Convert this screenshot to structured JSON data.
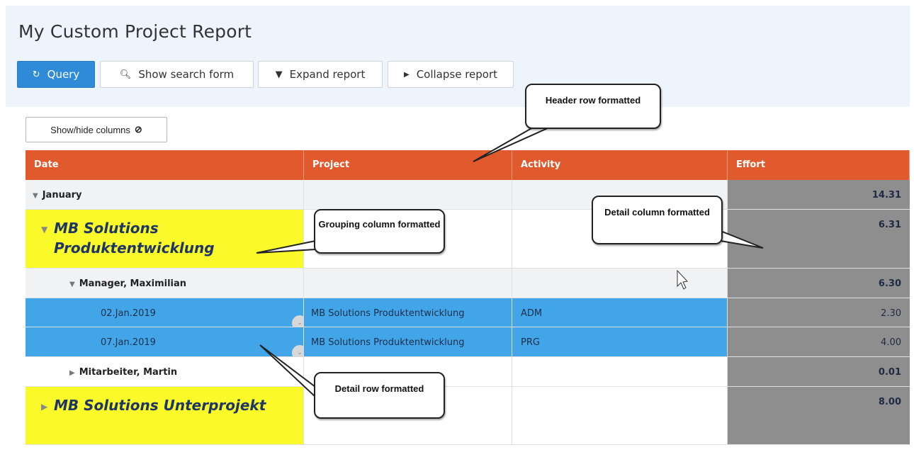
{
  "page": {
    "title": "My Custom Project Report"
  },
  "toolbar": {
    "query": "Query",
    "show_search_form": "Show search form",
    "expand_report": "Expand report",
    "collapse_report": "Collapse report",
    "show_hide_columns": "Show/hide columns"
  },
  "table": {
    "headers": [
      "Date",
      "Project",
      "Activity",
      "Effort"
    ],
    "rows": [
      {
        "label": "January",
        "effort": "14.31"
      },
      {
        "label": "MB Solutions Produktentwicklung",
        "effort": "6.31"
      },
      {
        "label": "Manager, Maximilian",
        "effort": "6.30"
      },
      {
        "date": "02.Jan.2019",
        "project": "MB Solutions Produktentwicklung",
        "activity": "ADM",
        "effort": "2.30"
      },
      {
        "date": "07.Jan.2019",
        "project": "MB Solutions Produktentwicklung",
        "activity": "PRG",
        "effort": "4.00"
      },
      {
        "label": "Mitarbeiter, Martin",
        "effort": "0.01"
      },
      {
        "label": "MB Solutions Unterprojekt",
        "effort": "8.00"
      }
    ]
  },
  "callouts": {
    "header_row": "Header row formatted",
    "grouping_column": "Grouping column formatted",
    "detail_column": "Detail column formatted",
    "detail_row": "Detail row formatted"
  },
  "colors": {
    "header": "#e05a2e",
    "primary_button": "#2f8ad8",
    "highlight_yellow": "#fafa2a",
    "detail_row_blue": "#42a5e8",
    "effort_column_grey": "#8e8e8e"
  }
}
